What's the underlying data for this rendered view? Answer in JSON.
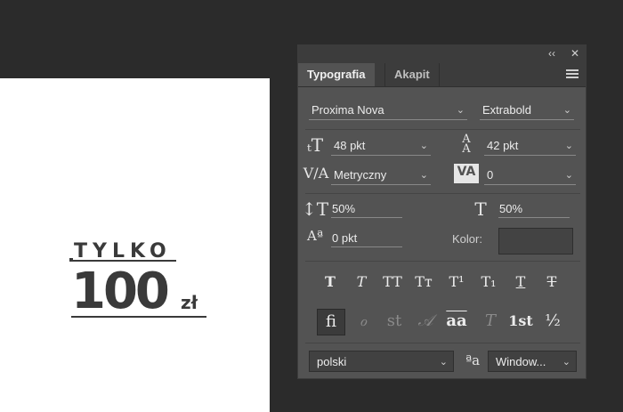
{
  "artwork": {
    "line1": "TYLKO",
    "line2": "100",
    "unit": "zł"
  },
  "panel": {
    "collapse_icon": "‹‹",
    "close_icon": "✕",
    "tabs": [
      {
        "label": "Typografia"
      },
      {
        "label": "Akapit"
      }
    ],
    "font_family": "Proxima Nova",
    "font_style": "Extrabold",
    "font_size": "48 pkt",
    "leading": "42 pkt",
    "kerning": "Metryczny",
    "tracking": "0",
    "vertical_scale": "50%",
    "horizontal_scale": "50%",
    "baseline_shift": "0 pkt",
    "color_label": "Kolor:",
    "type_buttons": [
      "T",
      "T",
      "TT",
      "Tт",
      "T¹",
      "T₁",
      "T",
      "T"
    ],
    "opentype_buttons": [
      "ﬁ",
      "ℴ",
      "st",
      "𝒜",
      "aa",
      "T",
      "1st",
      "½"
    ],
    "language": "polski",
    "antialias_icon": "ªa",
    "antialias": "Window...",
    "colors": {
      "swatch": "#434343"
    }
  }
}
